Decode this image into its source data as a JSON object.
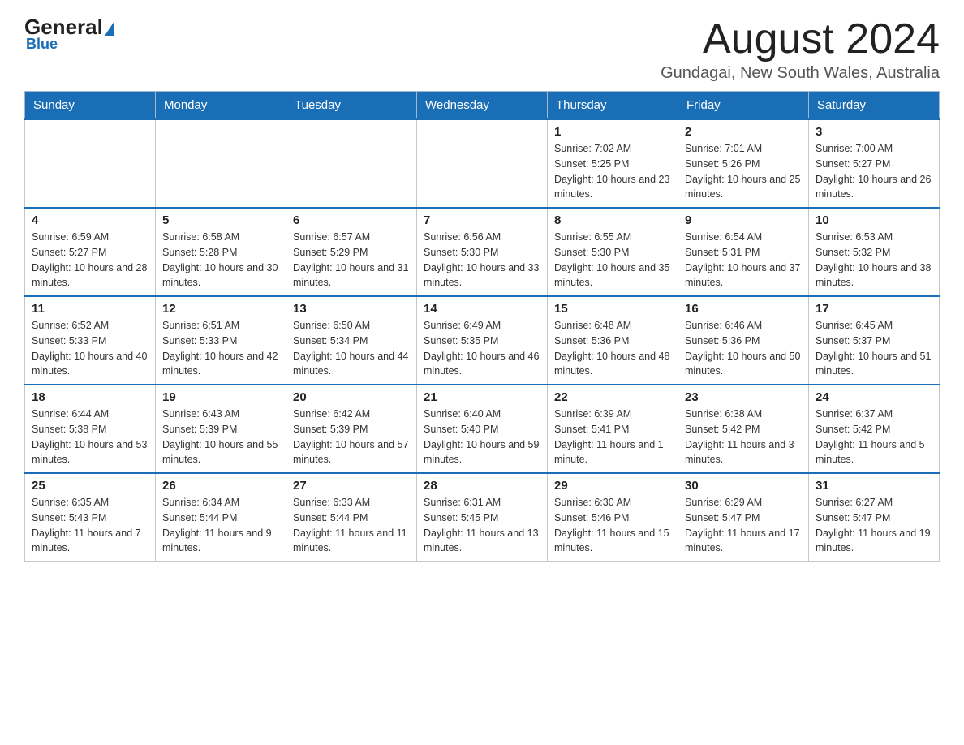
{
  "header": {
    "logo_general": "General",
    "logo_blue": "Blue",
    "month_year": "August 2024",
    "location": "Gundagai, New South Wales, Australia"
  },
  "weekdays": [
    "Sunday",
    "Monday",
    "Tuesday",
    "Wednesday",
    "Thursday",
    "Friday",
    "Saturday"
  ],
  "weeks": [
    [
      {
        "day": "",
        "info": ""
      },
      {
        "day": "",
        "info": ""
      },
      {
        "day": "",
        "info": ""
      },
      {
        "day": "",
        "info": ""
      },
      {
        "day": "1",
        "info": "Sunrise: 7:02 AM\nSunset: 5:25 PM\nDaylight: 10 hours and 23 minutes."
      },
      {
        "day": "2",
        "info": "Sunrise: 7:01 AM\nSunset: 5:26 PM\nDaylight: 10 hours and 25 minutes."
      },
      {
        "day": "3",
        "info": "Sunrise: 7:00 AM\nSunset: 5:27 PM\nDaylight: 10 hours and 26 minutes."
      }
    ],
    [
      {
        "day": "4",
        "info": "Sunrise: 6:59 AM\nSunset: 5:27 PM\nDaylight: 10 hours and 28 minutes."
      },
      {
        "day": "5",
        "info": "Sunrise: 6:58 AM\nSunset: 5:28 PM\nDaylight: 10 hours and 30 minutes."
      },
      {
        "day": "6",
        "info": "Sunrise: 6:57 AM\nSunset: 5:29 PM\nDaylight: 10 hours and 31 minutes."
      },
      {
        "day": "7",
        "info": "Sunrise: 6:56 AM\nSunset: 5:30 PM\nDaylight: 10 hours and 33 minutes."
      },
      {
        "day": "8",
        "info": "Sunrise: 6:55 AM\nSunset: 5:30 PM\nDaylight: 10 hours and 35 minutes."
      },
      {
        "day": "9",
        "info": "Sunrise: 6:54 AM\nSunset: 5:31 PM\nDaylight: 10 hours and 37 minutes."
      },
      {
        "day": "10",
        "info": "Sunrise: 6:53 AM\nSunset: 5:32 PM\nDaylight: 10 hours and 38 minutes."
      }
    ],
    [
      {
        "day": "11",
        "info": "Sunrise: 6:52 AM\nSunset: 5:33 PM\nDaylight: 10 hours and 40 minutes."
      },
      {
        "day": "12",
        "info": "Sunrise: 6:51 AM\nSunset: 5:33 PM\nDaylight: 10 hours and 42 minutes."
      },
      {
        "day": "13",
        "info": "Sunrise: 6:50 AM\nSunset: 5:34 PM\nDaylight: 10 hours and 44 minutes."
      },
      {
        "day": "14",
        "info": "Sunrise: 6:49 AM\nSunset: 5:35 PM\nDaylight: 10 hours and 46 minutes."
      },
      {
        "day": "15",
        "info": "Sunrise: 6:48 AM\nSunset: 5:36 PM\nDaylight: 10 hours and 48 minutes."
      },
      {
        "day": "16",
        "info": "Sunrise: 6:46 AM\nSunset: 5:36 PM\nDaylight: 10 hours and 50 minutes."
      },
      {
        "day": "17",
        "info": "Sunrise: 6:45 AM\nSunset: 5:37 PM\nDaylight: 10 hours and 51 minutes."
      }
    ],
    [
      {
        "day": "18",
        "info": "Sunrise: 6:44 AM\nSunset: 5:38 PM\nDaylight: 10 hours and 53 minutes."
      },
      {
        "day": "19",
        "info": "Sunrise: 6:43 AM\nSunset: 5:39 PM\nDaylight: 10 hours and 55 minutes."
      },
      {
        "day": "20",
        "info": "Sunrise: 6:42 AM\nSunset: 5:39 PM\nDaylight: 10 hours and 57 minutes."
      },
      {
        "day": "21",
        "info": "Sunrise: 6:40 AM\nSunset: 5:40 PM\nDaylight: 10 hours and 59 minutes."
      },
      {
        "day": "22",
        "info": "Sunrise: 6:39 AM\nSunset: 5:41 PM\nDaylight: 11 hours and 1 minute."
      },
      {
        "day": "23",
        "info": "Sunrise: 6:38 AM\nSunset: 5:42 PM\nDaylight: 11 hours and 3 minutes."
      },
      {
        "day": "24",
        "info": "Sunrise: 6:37 AM\nSunset: 5:42 PM\nDaylight: 11 hours and 5 minutes."
      }
    ],
    [
      {
        "day": "25",
        "info": "Sunrise: 6:35 AM\nSunset: 5:43 PM\nDaylight: 11 hours and 7 minutes."
      },
      {
        "day": "26",
        "info": "Sunrise: 6:34 AM\nSunset: 5:44 PM\nDaylight: 11 hours and 9 minutes."
      },
      {
        "day": "27",
        "info": "Sunrise: 6:33 AM\nSunset: 5:44 PM\nDaylight: 11 hours and 11 minutes."
      },
      {
        "day": "28",
        "info": "Sunrise: 6:31 AM\nSunset: 5:45 PM\nDaylight: 11 hours and 13 minutes."
      },
      {
        "day": "29",
        "info": "Sunrise: 6:30 AM\nSunset: 5:46 PM\nDaylight: 11 hours and 15 minutes."
      },
      {
        "day": "30",
        "info": "Sunrise: 6:29 AM\nSunset: 5:47 PM\nDaylight: 11 hours and 17 minutes."
      },
      {
        "day": "31",
        "info": "Sunrise: 6:27 AM\nSunset: 5:47 PM\nDaylight: 11 hours and 19 minutes."
      }
    ]
  ]
}
